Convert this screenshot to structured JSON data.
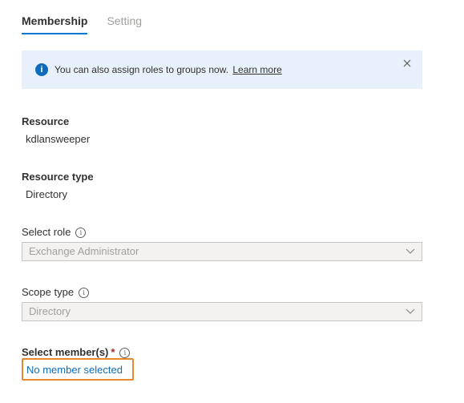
{
  "tabs": [
    {
      "label": "Membership",
      "active": true
    },
    {
      "label": "Setting",
      "active": false
    }
  ],
  "info": {
    "text": "You can also assign roles to groups now.",
    "link": "Learn more",
    "icon": "info-icon",
    "close_icon": "close-icon"
  },
  "resource": {
    "label": "Resource",
    "value": "kdlansweeper"
  },
  "resource_type": {
    "label": "Resource type",
    "value": "Directory"
  },
  "select_role": {
    "label": "Select role",
    "value": "Exchange Administrator",
    "help_icon": "info-icon"
  },
  "scope_type": {
    "label": "Scope type",
    "value": "Directory",
    "help_icon": "info-icon"
  },
  "select_members": {
    "label": "Select member(s)",
    "required_mark": "*",
    "link": "No member selected",
    "help_icon": "info-icon"
  },
  "colors": {
    "accent": "#0078d4",
    "info_background": "#e8f1fb",
    "link": "#0f6cbd",
    "highlight_border": "#e8872b",
    "required": "#a4262c"
  }
}
